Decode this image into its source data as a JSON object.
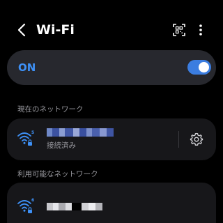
{
  "header": {
    "title": "Wi-Fi",
    "back_icon": "chevron-left-icon",
    "qr_icon": "qr-scan-icon",
    "more_icon": "more-vertical-icon"
  },
  "master_toggle": {
    "label": "ON",
    "state": true,
    "accent_color": "#3e91f7"
  },
  "current_network": {
    "section_title": "現在のネットワーク",
    "network": {
      "name_hidden": true,
      "status": "接続済み",
      "wifi_standard": "5",
      "secured": true,
      "settings_icon": "gear-icon"
    }
  },
  "available_networks": {
    "section_title": "利用可能なネットワーク",
    "networks": [
      {
        "name_hidden": true,
        "wifi_standard": "6",
        "secured": true
      }
    ]
  }
}
